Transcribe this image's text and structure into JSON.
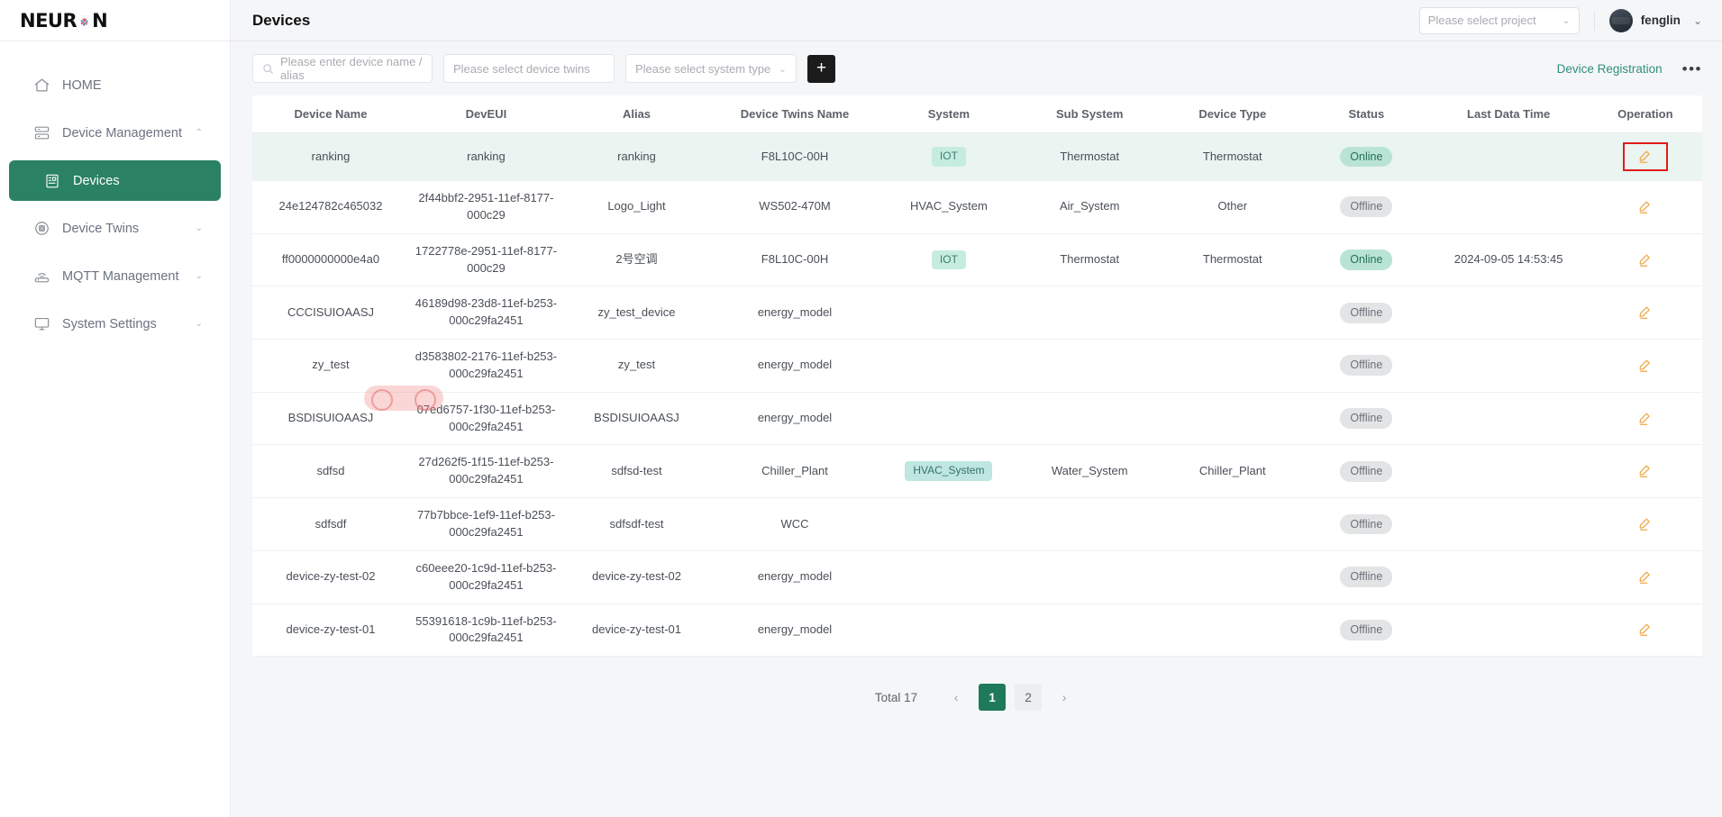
{
  "brand": {
    "name_left": "NEUR",
    "name_right": "N",
    "logo_icon": "neuron-logo"
  },
  "sidebar": {
    "items": [
      {
        "label": "HOME",
        "icon": "home-icon",
        "chevron": "",
        "active": false
      },
      {
        "label": "Device Management",
        "icon": "device-management-icon",
        "chevron": "⌃",
        "active": false
      },
      {
        "label": "Devices",
        "icon": "devices-icon",
        "chevron": "",
        "active": true
      },
      {
        "label": "Device Twins",
        "icon": "device-twins-icon",
        "chevron": "⌄",
        "active": false
      },
      {
        "label": "MQTT Management",
        "icon": "mqtt-icon",
        "chevron": "⌄",
        "active": false
      },
      {
        "label": "System Settings",
        "icon": "system-settings-icon",
        "chevron": "⌄",
        "active": false
      }
    ]
  },
  "header": {
    "title": "Devices",
    "project_select_placeholder": "Please select project",
    "user_name": "fenglin",
    "user_chevron": "⌄",
    "project_chevron": "⌄"
  },
  "toolbar": {
    "search_placeholder": "Please enter device name / alias",
    "twins_placeholder": "Please select device twins",
    "system_placeholder": "Please select system type",
    "add_label": "+",
    "registration_label": "Device Registration",
    "more_label": "•••"
  },
  "table": {
    "columns": [
      "Device Name",
      "DevEUI",
      "Alias",
      "Device Twins Name",
      "System",
      "Sub System",
      "Device Type",
      "Status",
      "Last Data Time",
      "Operation"
    ],
    "rows": [
      {
        "device_name": "ranking",
        "deveui": "ranking",
        "alias": "ranking",
        "twins_name": "F8L10C-00H",
        "system": "IOT",
        "system_tag": "iot",
        "sub_system": "Thermostat",
        "device_type": "Thermostat",
        "status": "Online",
        "last_data_time": "",
        "highlight": true,
        "op_boxed": true
      },
      {
        "device_name": "24e124782c465032",
        "deveui": "2f44bbf2-2951-11ef-8177-000c29",
        "alias": "Logo_Light",
        "twins_name": "WS502-470M",
        "system": "HVAC_System",
        "system_tag": "plain",
        "sub_system": "Air_System",
        "device_type": "Other",
        "status": "Offline",
        "last_data_time": "",
        "highlight": false,
        "op_boxed": false
      },
      {
        "device_name": "ff0000000000e4a0",
        "deveui": "1722778e-2951-11ef-8177-000c29",
        "alias": "2号空调",
        "twins_name": "F8L10C-00H",
        "system": "IOT",
        "system_tag": "iot",
        "sub_system": "Thermostat",
        "device_type": "Thermostat",
        "status": "Online",
        "last_data_time": "2024-09-05 14:53:45",
        "highlight": false,
        "op_boxed": false
      },
      {
        "device_name": "CCCISUIOAASJ",
        "deveui": "46189d98-23d8-11ef-b253-000c29fa2451",
        "alias": "zy_test_device",
        "twins_name": "energy_model",
        "system": "",
        "system_tag": "none",
        "sub_system": "",
        "device_type": "",
        "status": "Offline",
        "last_data_time": "",
        "highlight": false,
        "op_boxed": false
      },
      {
        "device_name": "zy_test",
        "deveui": "d3583802-2176-11ef-b253-000c29fa2451",
        "alias": "zy_test",
        "twins_name": "energy_model",
        "system": "",
        "system_tag": "none",
        "sub_system": "",
        "device_type": "",
        "status": "Offline",
        "last_data_time": "",
        "highlight": false,
        "op_boxed": false
      },
      {
        "device_name": "BSDISUIOAASJ",
        "deveui": "07ed6757-1f30-11ef-b253-000c29fa2451",
        "alias": "BSDISUIOAASJ",
        "twins_name": "energy_model",
        "system": "",
        "system_tag": "none",
        "sub_system": "",
        "device_type": "",
        "status": "Offline",
        "last_data_time": "",
        "highlight": false,
        "op_boxed": false
      },
      {
        "device_name": "sdfsd",
        "deveui": "27d262f5-1f15-11ef-b253-000c29fa2451",
        "alias": "sdfsd-test",
        "twins_name": "Chiller_Plant",
        "system": "HVAC_System",
        "system_tag": "hvac",
        "sub_system": "Water_System",
        "device_type": "Chiller_Plant",
        "status": "Offline",
        "last_data_time": "",
        "highlight": false,
        "op_boxed": false
      },
      {
        "device_name": "sdfsdf",
        "deveui": "77b7bbce-1ef9-11ef-b253-000c29fa2451",
        "alias": "sdfsdf-test",
        "twins_name": "WCC",
        "system": "",
        "system_tag": "none",
        "sub_system": "",
        "device_type": "",
        "status": "Offline",
        "last_data_time": "",
        "highlight": false,
        "op_boxed": false
      },
      {
        "device_name": "device-zy-test-02",
        "deveui": "c60eee20-1c9d-11ef-b253-000c29fa2451",
        "alias": "device-zy-test-02",
        "twins_name": "energy_model",
        "system": "",
        "system_tag": "none",
        "sub_system": "",
        "device_type": "",
        "status": "Offline",
        "last_data_time": "",
        "highlight": false,
        "op_boxed": false
      },
      {
        "device_name": "device-zy-test-01",
        "deveui": "55391618-1c9b-11ef-b253-000c29fa2451",
        "alias": "device-zy-test-01",
        "twins_name": "energy_model",
        "system": "",
        "system_tag": "none",
        "sub_system": "",
        "device_type": "",
        "status": "Offline",
        "last_data_time": "",
        "highlight": false,
        "op_boxed": false
      }
    ]
  },
  "pagination": {
    "total_label": "Total 17",
    "prev": "‹",
    "next": "›",
    "pages": [
      "1",
      "2"
    ],
    "current": "1"
  },
  "colors": {
    "accent_green": "#2a8163",
    "link_teal": "#2f8f7f",
    "highlight_row": "#eaf4f0",
    "online_badge": "#b9e4d5",
    "offline_badge": "#e3e4e6",
    "edit_icon": "#f0a84a",
    "focus_box": "#e11b1b"
  }
}
